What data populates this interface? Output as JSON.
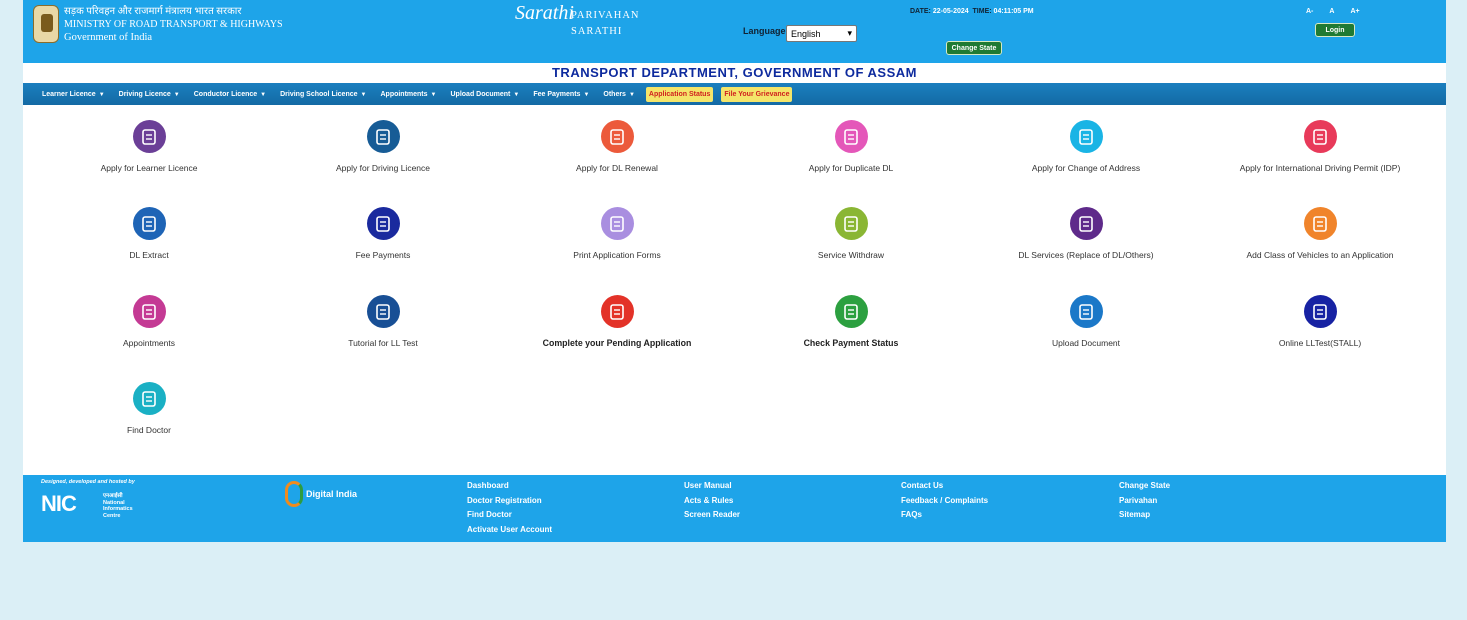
{
  "header": {
    "ministry_hindi": "सड़क परिवहन और राजमार्ग मंत्रालय भारत सरकार",
    "ministry_english": "MINISTRY OF ROAD TRANSPORT & HIGHWAYS",
    "government": "Government of India",
    "sarathi_logo_text": "Sarathi",
    "parivahan": "PARIVAHAN",
    "sarathi": "SARATHI",
    "language_label": "Language:",
    "language_value": "English",
    "date_label": "DATE:",
    "date_value": "22-05-2024",
    "time_label": "TIME:",
    "time_value": "04:11:05 PM",
    "change_state": "Change State",
    "font_sizes": [
      "A-",
      "A",
      "A+"
    ],
    "login": "Login"
  },
  "dept_title": "TRANSPORT DEPARTMENT, GOVERNMENT OF ASSAM",
  "nav": {
    "items": [
      "Learner Licence",
      "Driving Licence",
      "Conductor Licence",
      "Driving School Licence",
      "Appointments",
      "Upload Document",
      "Fee Payments",
      "Others"
    ],
    "application_status": "Application Status",
    "file_grievance": "File Your Grievance"
  },
  "tiles": [
    {
      "label": "Apply for Learner Licence",
      "color": "#6b3f97",
      "icon": "learner-licence-icon"
    },
    {
      "label": "Apply for Driving Licence",
      "color": "#175c96",
      "icon": "driving-licence-icon"
    },
    {
      "label": "Apply for DL Renewal",
      "color": "#ec5a3b",
      "icon": "dl-renewal-icon"
    },
    {
      "label": "Apply for Duplicate DL",
      "color": "#e457b9",
      "icon": "duplicate-dl-icon"
    },
    {
      "label": "Apply for Change of Address",
      "color": "#1ab4e5",
      "icon": "change-address-icon"
    },
    {
      "label": "Apply for International Driving Permit (IDP)",
      "color": "#e83a5a",
      "icon": "idp-icon"
    },
    {
      "label": "DL Extract",
      "color": "#1e64b6",
      "icon": "dl-extract-icon"
    },
    {
      "label": "Fee Payments",
      "color": "#1a2a9e",
      "icon": "fee-payments-icon"
    },
    {
      "label": "Print Application Forms",
      "color": "#a98ee0",
      "icon": "print-forms-icon"
    },
    {
      "label": "Service Withdraw",
      "color": "#8ab634",
      "icon": "service-withdraw-icon"
    },
    {
      "label": "DL Services (Replace of DL/Others)",
      "color": "#5e2a8a",
      "icon": "dl-services-icon"
    },
    {
      "label": "Add Class of Vehicles to an Application",
      "color": "#f0842b",
      "icon": "add-class-icon"
    },
    {
      "label": "Appointments",
      "color": "#c43a94",
      "icon": "appointments-icon"
    },
    {
      "label": "Tutorial for LL Test",
      "color": "#184f95",
      "icon": "tutorial-icon"
    },
    {
      "label": "Complete your Pending Application",
      "color": "#e33228",
      "icon": "pending-application-icon"
    },
    {
      "label": "Check Payment Status",
      "color": "#2ca040",
      "icon": "payment-status-icon"
    },
    {
      "label": "Upload Document",
      "color": "#1b78c8",
      "icon": "upload-document-icon"
    },
    {
      "label": "Online LLTest(STALL)",
      "color": "#1722a3",
      "icon": "online-lltest-icon"
    },
    {
      "label": "Find Doctor",
      "color": "#1ab0c4",
      "icon": "find-doctor-icon"
    }
  ],
  "footer": {
    "designed_by": "Designed, developed and hosted by",
    "nic_hindi": "एनआईसी",
    "nic_lines": [
      "National",
      "Informatics",
      "Centre"
    ],
    "digital_india": "Digital India",
    "col1": [
      "Dashboard",
      "Doctor Registration",
      "Find Doctor",
      "Activate User Account"
    ],
    "col2": [
      "User Manual",
      "Acts & Rules",
      "Screen Reader"
    ],
    "col3": [
      "Contact Us",
      "Feedback / Complaints",
      "FAQs"
    ],
    "col4": [
      "Change State",
      "Parivahan",
      "Sitemap"
    ]
  }
}
